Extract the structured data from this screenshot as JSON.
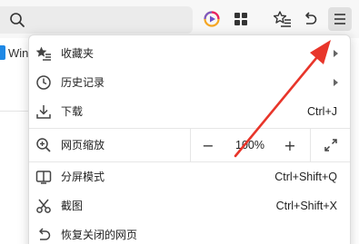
{
  "toolbar": {
    "icons": [
      "search-icon",
      "media-player-icon",
      "apps-grid-icon",
      "favorites-star-icon",
      "undo-icon",
      "menu-icon"
    ]
  },
  "bookmarks_bar": {
    "first_item_label": "Win"
  },
  "menu": {
    "favorites": {
      "label": "收藏夹"
    },
    "history": {
      "label": "历史记录"
    },
    "downloads": {
      "label": "下载",
      "shortcut": "Ctrl+J"
    },
    "zoom": {
      "label": "网页缩放",
      "decrease": "−",
      "value": "100%",
      "increase": "+"
    },
    "split_screen": {
      "label": "分屏模式",
      "shortcut": "Ctrl+Shift+Q"
    },
    "screenshot": {
      "label": "截图",
      "shortcut": "Ctrl+Shift+X"
    },
    "restore_closed": {
      "label": "恢复关闭的网页"
    }
  },
  "colors": {
    "annotation_arrow": "#e8352a",
    "bookmark_favicon": "#1e88e5"
  }
}
